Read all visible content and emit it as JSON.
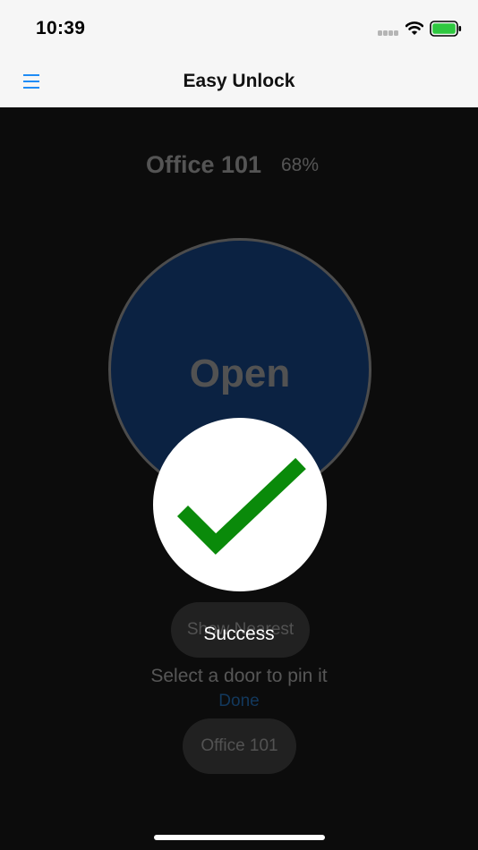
{
  "status_bar": {
    "time": "10:39",
    "icons": [
      "cellular-signal-icon",
      "wifi-icon",
      "battery-icon"
    ]
  },
  "nav": {
    "title": "Easy Unlock",
    "menu_icon": "hamburger-menu-icon"
  },
  "door": {
    "name": "Office 101",
    "battery": "68%"
  },
  "open_button": {
    "label": "Open"
  },
  "show_nearest_button": {
    "label": "Show Nearest"
  },
  "hint": "Select a door to pin it",
  "done_label": "Done",
  "pinned_door_button": {
    "label": "Office 101"
  },
  "toast": {
    "message": "Success",
    "icon": "checkmark-icon"
  },
  "colors": {
    "accent": "#1f8cf5",
    "open_button": "#0a4caa",
    "success_check": "#0a8a0a",
    "background": "#0c0c0c",
    "nav_background": "#f6f6f6"
  }
}
